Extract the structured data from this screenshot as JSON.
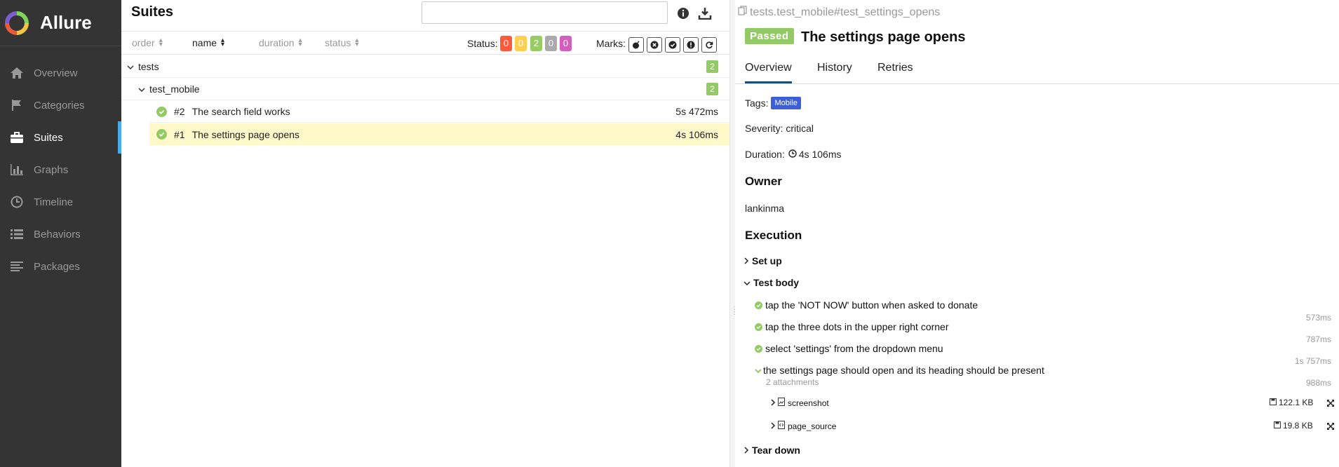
{
  "app": {
    "name": "Allure"
  },
  "sidebar": {
    "items": [
      {
        "label": "Overview",
        "icon": "home-icon"
      },
      {
        "label": "Categories",
        "icon": "flag-icon"
      },
      {
        "label": "Suites",
        "icon": "briefcase-icon",
        "active": true
      },
      {
        "label": "Graphs",
        "icon": "bar-chart-icon"
      },
      {
        "label": "Timeline",
        "icon": "clock-icon"
      },
      {
        "label": "Behaviors",
        "icon": "list-icon"
      },
      {
        "label": "Packages",
        "icon": "align-left-icon"
      }
    ]
  },
  "suites": {
    "title": "Suites",
    "search": {
      "placeholder": "",
      "value": ""
    },
    "sort": {
      "order": "order",
      "name": "name",
      "duration": "duration",
      "status": "status"
    },
    "status_label": "Status:",
    "status_counts": [
      {
        "value": "0",
        "color": "#fd5a3e"
      },
      {
        "value": "0",
        "color": "#ffd050"
      },
      {
        "value": "2",
        "color": "#97cc64"
      },
      {
        "value": "0",
        "color": "#aaaaaa"
      },
      {
        "value": "0",
        "color": "#d35ebe"
      }
    ],
    "marks_label": "Marks:",
    "tree": {
      "root": {
        "name": "tests",
        "count": "2"
      },
      "child": {
        "name": "test_mobile",
        "count": "2"
      },
      "tests": [
        {
          "num": "#2",
          "name": "The search field works",
          "duration": "5s 472ms"
        },
        {
          "num": "#1",
          "name": "The settings page opens",
          "duration": "4s 106ms"
        }
      ]
    }
  },
  "detail": {
    "breadcrumb": "tests.test_mobile#test_settings_opens",
    "status": "Passed",
    "title": "The settings page opens",
    "tabs": [
      "Overview",
      "History",
      "Retries"
    ],
    "tags_label": "Tags:",
    "tag": "Mobile",
    "severity": "Severity: critical",
    "duration_label": "Duration:",
    "duration": "4s 106ms",
    "owner_heading": "Owner",
    "owner": "lankinma",
    "execution_heading": "Execution",
    "setup": "Set up",
    "test_body": "Test body",
    "steps": [
      {
        "name": "tap the 'NOT NOW' button when asked to donate",
        "duration": "573ms"
      },
      {
        "name": "tap the three dots in the upper right corner",
        "duration": "787ms"
      },
      {
        "name": "select 'settings' from the dropdown menu",
        "duration": "1s 757ms"
      },
      {
        "name": "the settings page should open and its heading should be present",
        "duration": "988ms"
      }
    ],
    "attachments_count": "2 attachments",
    "attachments": [
      {
        "name": "screenshot",
        "size": "122.1 KB"
      },
      {
        "name": "page_source",
        "size": "19.8 KB"
      }
    ],
    "teardown": "Tear down"
  },
  "colors": {
    "sidebar_bg": "#343434",
    "accent": "#4baae8",
    "passed": "#94ca66",
    "tag": "#3c5fd7",
    "selected_row": "#fff8c8"
  }
}
